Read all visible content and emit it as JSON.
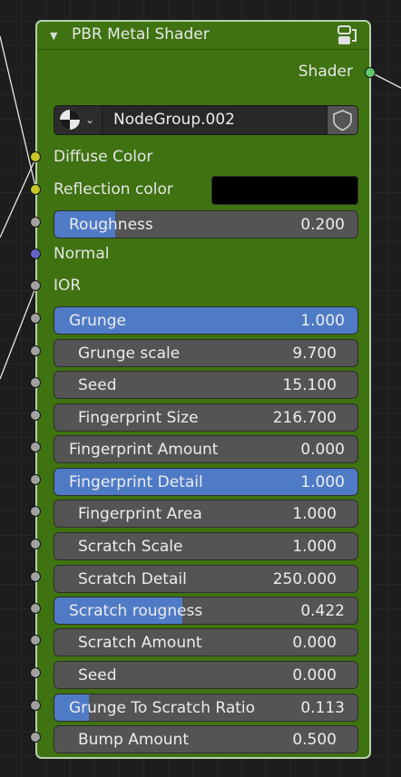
{
  "node": {
    "title": "PBR Metal Shader",
    "output": {
      "label": "Shader",
      "socket": "green"
    },
    "group_selector": {
      "name": "NodeGroup.002"
    },
    "inputs": [
      {
        "label": "Diffuse Color",
        "type": "color_socket",
        "socket": "yellow"
      },
      {
        "label": "Reflection color",
        "type": "color",
        "socket": "yellow",
        "color": "#000000"
      },
      {
        "label": "Roughness",
        "type": "slider",
        "value": "0.200",
        "fraction": 0.2,
        "socket": "grey"
      },
      {
        "label": "Normal",
        "type": "socket",
        "socket": "blue"
      },
      {
        "label": "IOR",
        "type": "socket",
        "socket": "grey"
      },
      {
        "label": "Grunge",
        "type": "slider",
        "value": "1.000",
        "fraction": 1.0,
        "socket": "grey"
      },
      {
        "label": "Grunge scale",
        "type": "number",
        "value": "9.700",
        "socket": "grey"
      },
      {
        "label": "Seed",
        "type": "number",
        "value": "15.100",
        "socket": "grey"
      },
      {
        "label": "Fingerprint Size",
        "type": "number",
        "value": "216.700",
        "socket": "grey"
      },
      {
        "label": "Fingerprint Amount",
        "type": "slider",
        "value": "0.000",
        "fraction": 0.0,
        "socket": "grey"
      },
      {
        "label": "Fingerprint Detail",
        "type": "slider",
        "value": "1.000",
        "fraction": 1.0,
        "socket": "grey"
      },
      {
        "label": "Fingerprint Area",
        "type": "number",
        "value": "1.000",
        "socket": "grey"
      },
      {
        "label": "Scratch Scale",
        "type": "number",
        "value": "1.000",
        "socket": "grey"
      },
      {
        "label": "Scratch Detail",
        "type": "number",
        "value": "250.000",
        "socket": "grey"
      },
      {
        "label": "Scratch rougness",
        "type": "slider",
        "value": "0.422",
        "fraction": 0.422,
        "socket": "grey"
      },
      {
        "label": "Scratch  Amount",
        "type": "number",
        "value": "0.000",
        "socket": "grey"
      },
      {
        "label": "Seed",
        "type": "number",
        "value": "0.000",
        "socket": "grey"
      },
      {
        "label": "Grunge To Scratch Ratio",
        "type": "slider",
        "value": "0.113",
        "fraction": 0.113,
        "socket": "grey"
      },
      {
        "label": "Bump Amount",
        "type": "number",
        "value": "0.500",
        "socket": "grey"
      }
    ]
  },
  "colors": {
    "node_body": "#3f7210",
    "node_border": "#b8d1b2",
    "field_bg": "#545454",
    "slider_fill": "#4f7bc6",
    "socket_yellow": "#c7c729",
    "socket_grey": "#a1a1a1",
    "socket_blue": "#6363c7",
    "socket_green": "#5fc86b"
  },
  "icons": {
    "collapse": "triangle-down-icon",
    "node_group": "node-group-icon",
    "material_ball": "material-ball-icon",
    "dropdown": "chevron-down-icon",
    "fake_user": "shield-icon"
  }
}
